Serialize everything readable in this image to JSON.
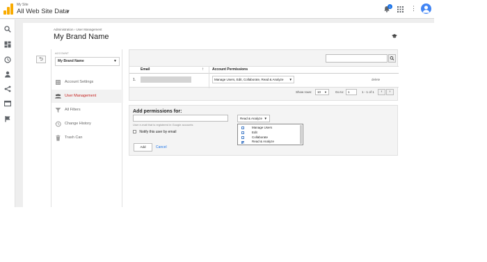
{
  "topbar": {
    "site_name": "My Site",
    "property_name": "All Web Site Data",
    "notification_count": "1",
    "icons": [
      "analytics-logo-icon",
      "bell-icon",
      "apps-grid-icon",
      "more-vert-icon",
      "account-avatar-icon"
    ]
  },
  "rail": {
    "icons": [
      "search-icon",
      "dashboard-icon",
      "clock-icon",
      "person-icon",
      "acquisition-icon",
      "behavior-icon",
      "flag-icon"
    ]
  },
  "admin": {
    "breadcrumb": "Administration › User Management",
    "title": "My Brand Name"
  },
  "account": {
    "label": "ACCOUNT",
    "selected": "My Brand Name"
  },
  "nav": {
    "items": [
      {
        "label": "Account Settings",
        "icon": "building-icon"
      },
      {
        "label": "User Management",
        "icon": "users-icon"
      },
      {
        "label": "All Filters",
        "icon": "filter-icon"
      },
      {
        "label": "Change History",
        "icon": "history-icon"
      },
      {
        "label": "Trash Can",
        "icon": "trash-icon"
      }
    ],
    "active_index": 1
  },
  "users_table": {
    "columns": [
      "Email",
      "Account Permissions"
    ],
    "rows": [
      {
        "index": "1.",
        "permissions": "Manage Users, Edit, Collaborate, Read & Analyze",
        "action": "delete"
      }
    ],
    "show_rows_label": "Show rows:",
    "show_rows_value": "10",
    "goto_label": "Go to:",
    "goto_value": "1",
    "range": "1 - 1 of 1"
  },
  "add_permissions": {
    "title": "Add permissions for:",
    "email_hint": "User e-mail that is registered in Google accounts",
    "role_selected": "Read & Analyze",
    "roles": [
      {
        "label": "Manage Users",
        "checked": false
      },
      {
        "label": "Edit",
        "checked": false
      },
      {
        "label": "Collaborate",
        "checked": false
      },
      {
        "label": "Read & Analyze",
        "checked": true
      }
    ],
    "notify_label": "Notify this user by email",
    "add_button": "Add",
    "cancel_link": "Cancel"
  },
  "colors": {
    "accent_red": "#c5221f",
    "link_blue": "#1a73e8",
    "logo_orange": "#f9ab00"
  }
}
